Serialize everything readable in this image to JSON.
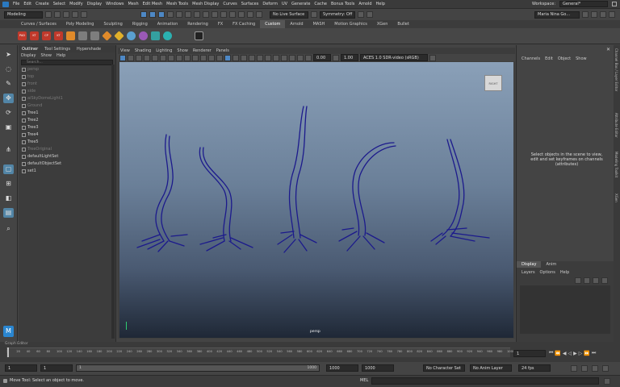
{
  "menubar": {
    "items": [
      "File",
      "Edit",
      "Create",
      "Select",
      "Modify",
      "Display",
      "Windows",
      "Mesh",
      "Edit Mesh",
      "Mesh Tools",
      "Mesh Display",
      "Curves",
      "Surfaces",
      "Deform",
      "UV",
      "Generate",
      "Cache",
      "Bonus Tools",
      "Arnold",
      "Help"
    ],
    "workspace_label": "Workspace:",
    "workspace_value": "General*"
  },
  "status": {
    "mode": "Modeling",
    "live_surface": "No Live Surface",
    "symmetry": "Symmetry: Off",
    "user": "Maria Nina Go..."
  },
  "shelf_tabs": [
    "Curves / Surfaces",
    "Poly Modeling",
    "Sculpting",
    "Rigging",
    "Animation",
    "Rendering",
    "FX",
    "FX Caching",
    "Custom",
    "Arnold",
    "MASH",
    "Motion Graphics",
    "XGen",
    "Bullet"
  ],
  "shelf_active": "Custom",
  "shelf_icon_labels": [
    "PAD",
    "KT",
    "CP",
    "KT"
  ],
  "outliner": {
    "tabs": [
      "Outliner",
      "Tool Settings",
      "Hypershade"
    ],
    "menu": [
      "Display",
      "Show",
      "Help"
    ],
    "search_placeholder": "Search...",
    "items": [
      {
        "label": "persp",
        "dim": true
      },
      {
        "label": "top",
        "dim": true
      },
      {
        "label": "front",
        "dim": true
      },
      {
        "label": "side",
        "dim": true
      },
      {
        "label": "aiSkyDomeLight1",
        "dim": true
      },
      {
        "label": "Ground",
        "dim": true
      },
      {
        "label": "Tree1",
        "dim": false
      },
      {
        "label": "Tree2",
        "dim": false
      },
      {
        "label": "Tree3",
        "dim": false
      },
      {
        "label": "Tree4",
        "dim": false
      },
      {
        "label": "Tree5",
        "dim": false
      },
      {
        "label": "TreeOriginal",
        "dim": true
      },
      {
        "label": "defaultLightSet",
        "dim": false
      },
      {
        "label": "defaultObjectSet",
        "dim": false
      },
      {
        "label": "set1",
        "dim": false
      }
    ]
  },
  "viewport": {
    "menu": [
      "View",
      "Shading",
      "Lighting",
      "Show",
      "Renderer",
      "Panels"
    ],
    "near": "0.00",
    "far": "1.00",
    "color_space": "ACES 1.0 SDR-video (sRGB)",
    "camera_label": "persp",
    "viewcube_label": "RIGHT"
  },
  "channelbox": {
    "menu": [
      "Channels",
      "Edit",
      "Object",
      "Show"
    ],
    "empty_text": "Select objects in the scene to view, edit and set keyframes on channels (attributes)",
    "layer_tabs": [
      "Display",
      "Anim"
    ],
    "layer_menu": [
      "Layers",
      "Options",
      "Help"
    ]
  },
  "right_strip_labels": [
    "Channel Box / Layer Editor",
    "Attribute Editor",
    "Modeling Toolkit",
    "XGen"
  ],
  "graph_editor_label": "Graph Editor",
  "timeline": {
    "ticks": [
      "1",
      "20",
      "40",
      "60",
      "80",
      "100",
      "120",
      "140",
      "160",
      "180",
      "200",
      "220",
      "240",
      "260",
      "280",
      "300",
      "320",
      "340",
      "360",
      "380",
      "400",
      "420",
      "440",
      "460",
      "480",
      "500",
      "520",
      "540",
      "560",
      "580",
      "600",
      "620",
      "640",
      "660",
      "680",
      "700",
      "720",
      "740",
      "760",
      "780",
      "800",
      "820",
      "840",
      "860",
      "880",
      "900",
      "920",
      "940",
      "960",
      "980",
      "1000"
    ],
    "current_frame": "1"
  },
  "range": {
    "start": "1",
    "inner_start": "1",
    "inner_end": "1000",
    "end": "1000",
    "anim_end": "1000",
    "character_set": "No Character Set",
    "anim_layer": "No Anim Layer",
    "fps": "24 fps"
  },
  "helpline": {
    "text": "Move Tool: Select an object to move.",
    "mel_label": "MEL"
  },
  "colors": {
    "accent": "#5285a6",
    "tree_wire": "#1c1a8c"
  }
}
